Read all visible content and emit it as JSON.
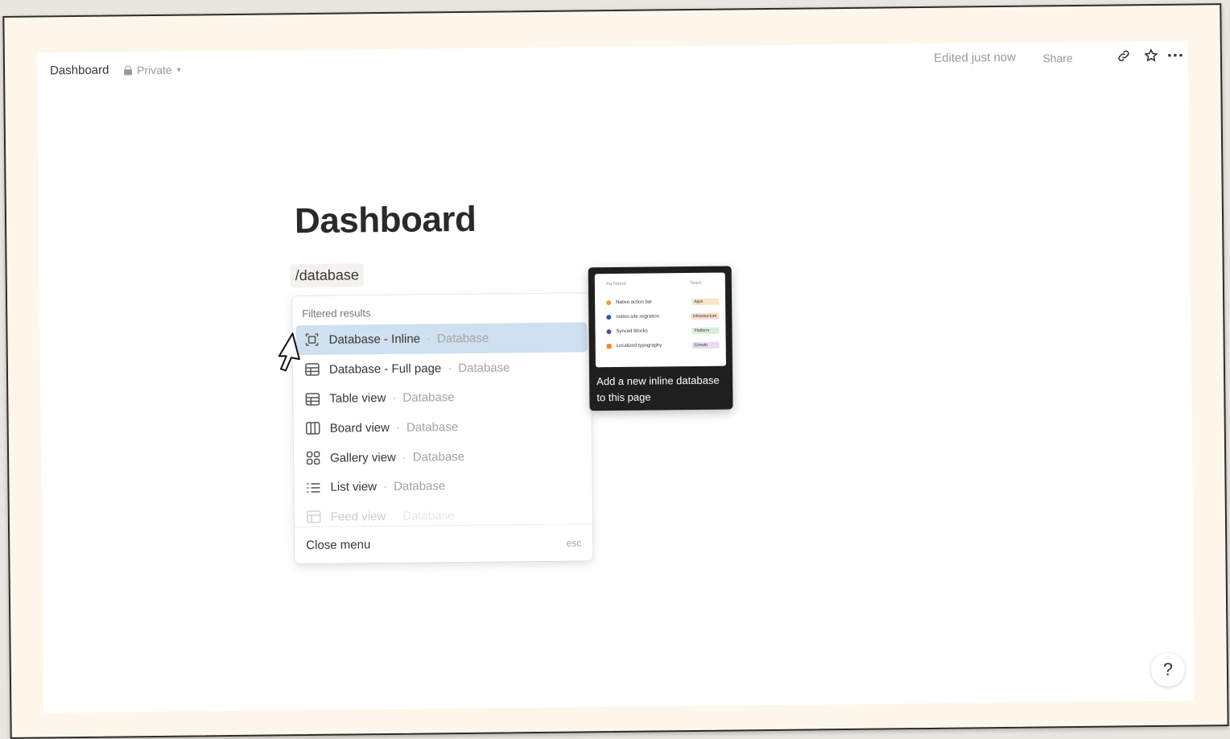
{
  "topbar": {
    "breadcrumb": "Dashboard",
    "privacy_label": "Private",
    "edited_label": "Edited just now",
    "share_label": "Share"
  },
  "page": {
    "title": "Dashboard",
    "command_text": "/database"
  },
  "menu": {
    "header": "Filtered results",
    "items": [
      {
        "label": "Database - Inline",
        "kind": "Database",
        "icon": "inline-database-icon",
        "active": true
      },
      {
        "label": "Database - Full page",
        "kind": "Database",
        "icon": "table-icon"
      },
      {
        "label": "Table view",
        "kind": "Database",
        "icon": "table-icon"
      },
      {
        "label": "Board view",
        "kind": "Database",
        "icon": "board-icon"
      },
      {
        "label": "Gallery view",
        "kind": "Database",
        "icon": "gallery-icon"
      },
      {
        "label": "List view",
        "kind": "Database",
        "icon": "list-icon"
      },
      {
        "label": "Feed view",
        "kind": "Database",
        "icon": "feed-icon"
      }
    ],
    "close_label": "Close menu",
    "close_shortcut": "esc"
  },
  "preview": {
    "caption": "Add a new inline database to this page",
    "columns": [
      "Aa Name",
      "Team"
    ],
    "rows": [
      {
        "name": "Native action bar",
        "tag": "Apps",
        "dot": "#e0a040",
        "tag_color": "#f5e6c8"
      },
      {
        "name": "notion.site migration",
        "tag": "Infrastructure",
        "dot": "#2f5aa0",
        "tag_color": "#f7dccf"
      },
      {
        "name": "Synced Blocks",
        "tag": "Platform",
        "dot": "#6a3fa0",
        "tag_color": "#d6efd8"
      },
      {
        "name": "Localized typography",
        "tag": "Growth",
        "dot": "#f08a30",
        "tag_color": "#e6dcf3"
      }
    ]
  },
  "colors": {
    "active_item": "#cfe0f0",
    "frame_bg": "#fdf6ea"
  }
}
